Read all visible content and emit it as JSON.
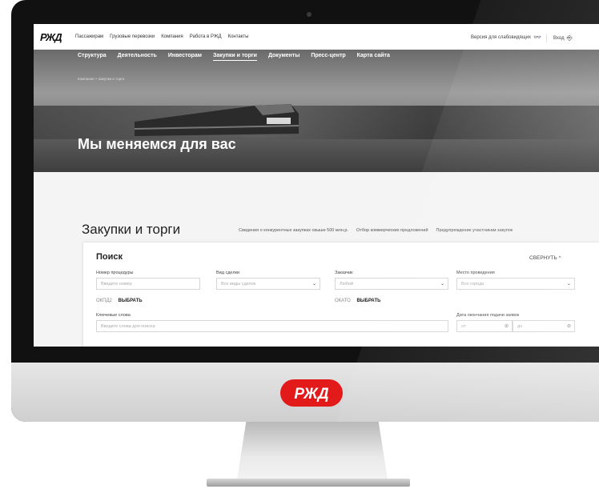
{
  "topbar": {
    "logo": "РЖД",
    "links": [
      "Пассажирам",
      "Грузовые перевозки",
      "Компания",
      "Работа в РЖД",
      "Контакты"
    ],
    "accessibility": "Версия для слабовидящих",
    "login": "Вход"
  },
  "nav": {
    "items": [
      "Структура",
      "Деятельность",
      "Инвесторам",
      "Закупки и торги",
      "Документы",
      "Пресс-центр",
      "Карта сайта"
    ],
    "active_index": 3
  },
  "breadcrumb": "Компания  >  Закупки и торги",
  "hero": {
    "title": "Мы меняемся для вас"
  },
  "main": {
    "title": "Закупки и торги",
    "links": [
      "Сведения о конкурентных закупках свыше 500 млн.р.",
      "Отбор коммерческих предложений",
      "Предупреждение участникам закупок"
    ]
  },
  "search": {
    "title": "Поиск",
    "collapse": "СВЕРНУТЬ",
    "procedure_number": {
      "label": "Номер процедуры",
      "placeholder": "Введите номер"
    },
    "deal_type": {
      "label": "Вид сделки",
      "value": "Все виды сделок"
    },
    "customer": {
      "label": "Заказчик",
      "value": "Любой"
    },
    "venue": {
      "label": "Место проведения",
      "value": "Все города"
    },
    "okpd2": {
      "label": "ОКПД2",
      "action": "ВЫБРАТЬ"
    },
    "okato": {
      "label": "ОКАТО",
      "action": "ВЫБРАТЬ"
    },
    "keywords": {
      "label": "Ключевые слова",
      "placeholder": "Введите слова для поиска"
    },
    "deadline": {
      "label": "Дата окончания подачи заявок",
      "from": "от",
      "to": "до"
    }
  },
  "brand_color": "#e21a1a",
  "device_logo": "РЖД"
}
